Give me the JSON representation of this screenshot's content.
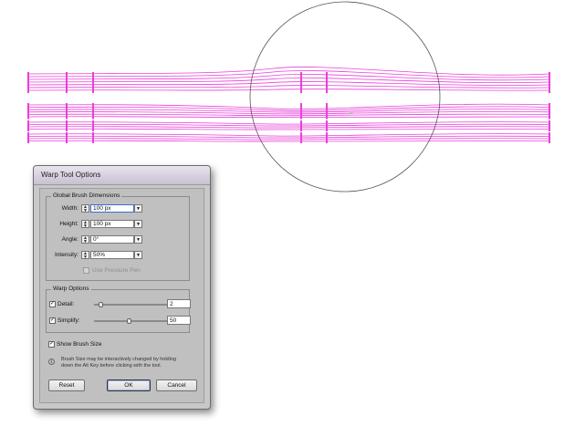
{
  "canvas": {
    "stroke_color": "#e840d8",
    "brush_circle_color": "#555555"
  },
  "dialog": {
    "title": "Warp Tool Options",
    "global_brush": {
      "section_title": "Global Brush Dimensions",
      "width_label": "Width:",
      "width_value": "100 px",
      "height_label": "Height:",
      "height_value": "100 px",
      "angle_label": "Angle:",
      "angle_value": "0°",
      "intensity_label": "Intensity:",
      "intensity_value": "50%",
      "use_pressure_pen_label": "Use Pressure Pen",
      "use_pressure_pen_checked": false
    },
    "warp_options": {
      "section_title": "Warp Options",
      "detail_label": "Detail:",
      "detail_value": "2",
      "detail_checked": true,
      "simplify_label": "Simplify:",
      "simplify_value": "50",
      "simplify_checked": true
    },
    "show_brush_size_label": "Show Brush Size",
    "show_brush_size_checked": true,
    "info_text": "Brush Size may be interactively changed by holding down the Alt Key before clicking with the tool.",
    "buttons": {
      "reset": "Reset",
      "ok": "OK",
      "cancel": "Cancel"
    }
  },
  "icons": {
    "spinner": "spinner-arrows-icon",
    "dropdown": "dropdown-arrow-icon",
    "info": "info-icon",
    "check": "checkmark-icon"
  }
}
